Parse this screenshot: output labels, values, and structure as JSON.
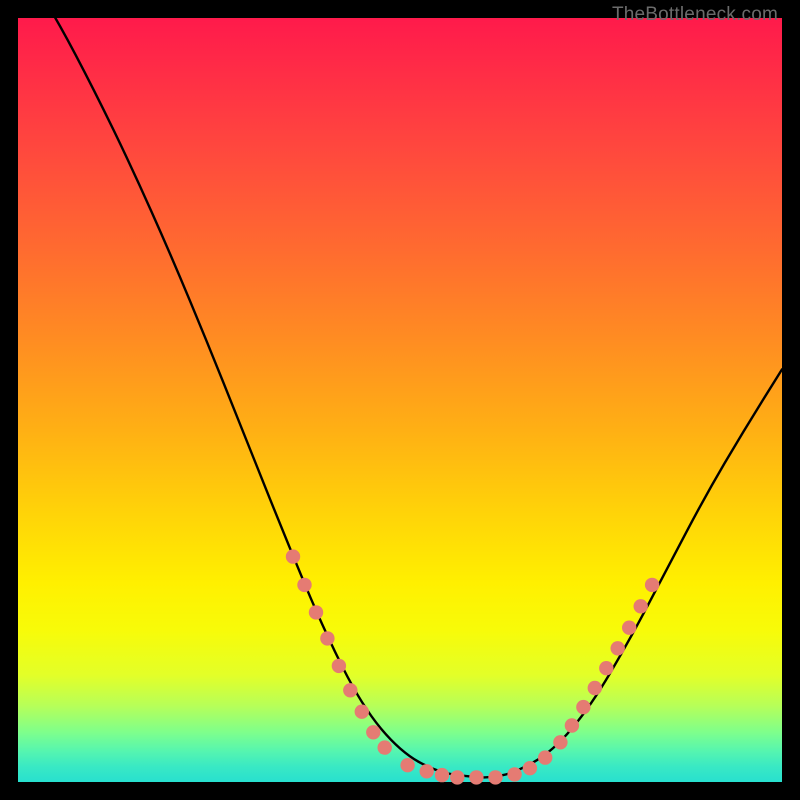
{
  "watermark": "TheBottleneck.com",
  "colors": {
    "background_frame": "#000000",
    "gradient_top": "#ff1a4b",
    "gradient_bottom": "#28e0cf",
    "curve_stroke": "#000000",
    "marker_fill": "#e57b73"
  },
  "chart_data": {
    "type": "line",
    "title": "",
    "xlabel": "",
    "ylabel": "",
    "xlim": [
      0,
      100
    ],
    "ylim": [
      0,
      100
    ],
    "grid": false,
    "legend": false,
    "x": [
      0,
      5,
      10,
      15,
      20,
      25,
      30,
      35,
      40,
      45,
      50,
      55,
      60,
      62,
      65,
      70,
      75,
      80,
      85,
      90,
      95,
      100
    ],
    "y": [
      108,
      100,
      90.5,
      80.2,
      69,
      57,
      44.5,
      32,
      20,
      10,
      4,
      1.2,
      0.6,
      0.6,
      1.2,
      4,
      10,
      18.5,
      28,
      37.5,
      46,
      54
    ],
    "series": [
      {
        "name": "markers-left",
        "x": [
          36,
          37.5,
          39,
          40.5,
          42,
          43.5,
          45,
          46.5,
          48
        ],
        "y": [
          29.5,
          25.8,
          22.2,
          18.8,
          15.2,
          12,
          9.2,
          6.5,
          4.5
        ]
      },
      {
        "name": "markers-bottom",
        "x": [
          51,
          53.5,
          55.5,
          57.5,
          60,
          62.5,
          65,
          67,
          69
        ],
        "y": [
          2.2,
          1.4,
          0.9,
          0.6,
          0.6,
          0.6,
          1.0,
          1.8,
          3.2
        ]
      },
      {
        "name": "markers-right",
        "x": [
          71,
          72.5,
          74,
          75.5,
          77,
          78.5,
          80,
          81.5,
          83
        ],
        "y": [
          5.2,
          7.4,
          9.8,
          12.3,
          14.9,
          17.5,
          20.2,
          23.0,
          25.8
        ]
      }
    ],
    "notes": "Axes are unlabeled; values expressed as 0–100 percent of plot extent. y measured from plot bottom upward. Line starts above visible area (y≈108) at left edge."
  }
}
